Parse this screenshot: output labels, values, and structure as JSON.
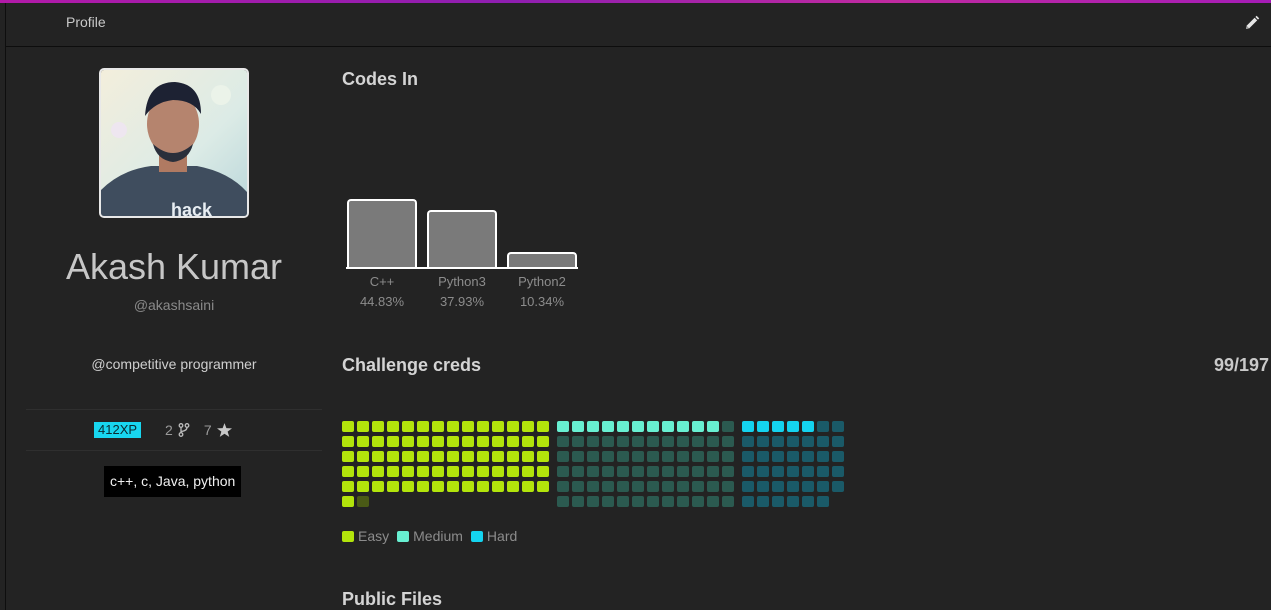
{
  "header": {
    "title": "Profile",
    "edit_icon": "pencil-icon"
  },
  "profile": {
    "name": "Akash Kumar",
    "handle": "@akashsaini",
    "bio": "@competitive programmer",
    "xp": "412XP",
    "forks": "2",
    "stars": "7",
    "languages": "c++, c, Java, python"
  },
  "codes_in": {
    "title": "Codes In",
    "chart_data": {
      "type": "bar",
      "categories": [
        "C++",
        "Python3",
        "Python2"
      ],
      "values": [
        44.83,
        37.93,
        10.34
      ],
      "labels": [
        "44.83%",
        "37.93%",
        "10.34%"
      ],
      "title": "Codes In",
      "ylim": [
        0,
        100
      ]
    }
  },
  "challenge_creds": {
    "title": "Challenge creds",
    "score": "99/197",
    "easy": {
      "solved": 71,
      "total": 72,
      "color": "#b2e40b"
    },
    "medium": {
      "solved": 11,
      "total": 72,
      "color": "#68f0d2"
    },
    "hard": {
      "solved": 5,
      "total": 41,
      "color": "#14d3ef"
    },
    "legend": [
      "Easy",
      "Medium",
      "Hard"
    ]
  },
  "public_files": {
    "title": "Public Files"
  },
  "colors": {
    "accent_xp": "#18d6ef",
    "background": "#232323"
  }
}
